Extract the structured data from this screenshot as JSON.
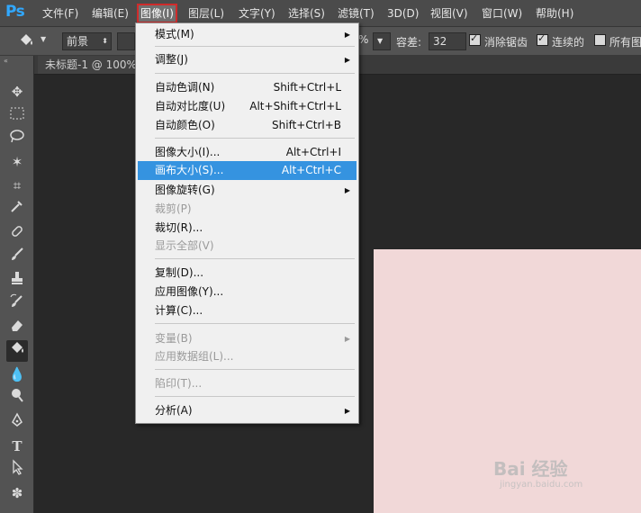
{
  "app": {
    "logo": "Ps"
  },
  "menubar": {
    "items": [
      {
        "label": "文件(F)"
      },
      {
        "label": "编辑(E)"
      },
      {
        "label": "图像(I)"
      },
      {
        "label": "图层(L)"
      },
      {
        "label": "文字(Y)"
      },
      {
        "label": "选择(S)"
      },
      {
        "label": "滤镜(T)"
      },
      {
        "label": "3D(D)"
      },
      {
        "label": "视图(V)"
      },
      {
        "label": "窗口(W)"
      },
      {
        "label": "帮助(H)"
      }
    ],
    "active_index": 2
  },
  "options_bar": {
    "fill_source": "前景",
    "opacity_suffix": "%",
    "tolerance_label": "容差:",
    "tolerance_value": "32",
    "anti_alias_label": "消除锯齿",
    "contiguous_label": "连续的",
    "all_layers_label": "所有图"
  },
  "document": {
    "tab_title": "未标题-1 @ 100%"
  },
  "image_menu": {
    "items": [
      {
        "label": "模式(M)",
        "submenu": true
      },
      {
        "label": "调整(J)",
        "submenu": true
      },
      {
        "label": "自动色调(N)",
        "shortcut": "Shift+Ctrl+L"
      },
      {
        "label": "自动对比度(U)",
        "shortcut": "Alt+Shift+Ctrl+L"
      },
      {
        "label": "自动颜色(O)",
        "shortcut": "Shift+Ctrl+B"
      },
      {
        "label": "图像大小(I)...",
        "shortcut": "Alt+Ctrl+I"
      },
      {
        "label": "画布大小(S)...",
        "shortcut": "Alt+Ctrl+C",
        "highlighted": true
      },
      {
        "label": "图像旋转(G)",
        "submenu": true
      },
      {
        "label": "裁剪(P)",
        "disabled": true
      },
      {
        "label": "裁切(R)..."
      },
      {
        "label": "显示全部(V)",
        "disabled": true
      },
      {
        "label": "复制(D)..."
      },
      {
        "label": "应用图像(Y)..."
      },
      {
        "label": "计算(C)..."
      },
      {
        "label": "变量(B)",
        "submenu": true,
        "disabled": true
      },
      {
        "label": "应用数据组(L)...",
        "disabled": true
      },
      {
        "label": "陷印(T)...",
        "disabled": true
      },
      {
        "label": "分析(A)",
        "submenu": true
      }
    ]
  },
  "watermark": {
    "text": "Bai 经验",
    "sub": "jingyan.baidu.com"
  },
  "colors": {
    "highlight": "#3593e0",
    "active_outline": "#cf2b2b",
    "canvas_fill": "#f1d8d8"
  }
}
